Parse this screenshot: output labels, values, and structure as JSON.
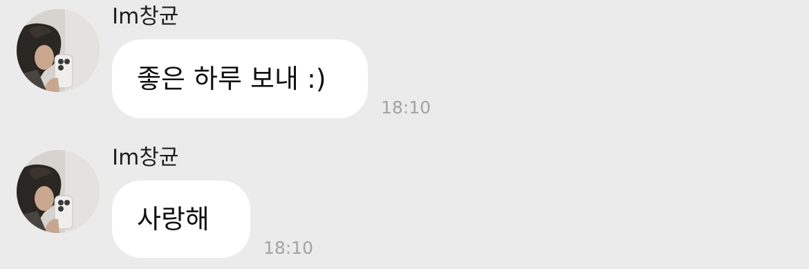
{
  "colors": {
    "background": "#ebebeb",
    "bubble": "#ffffff",
    "text": "#111111",
    "timestamp": "#a3a3a3"
  },
  "messages": [
    {
      "sender": "Im창균",
      "avatar_icon": "profile-photo",
      "text": "좋은 하루 보내 :)",
      "time": "18:10"
    },
    {
      "sender": "Im창균",
      "avatar_icon": "profile-photo",
      "text": "사랑해",
      "time": "18:10"
    }
  ]
}
